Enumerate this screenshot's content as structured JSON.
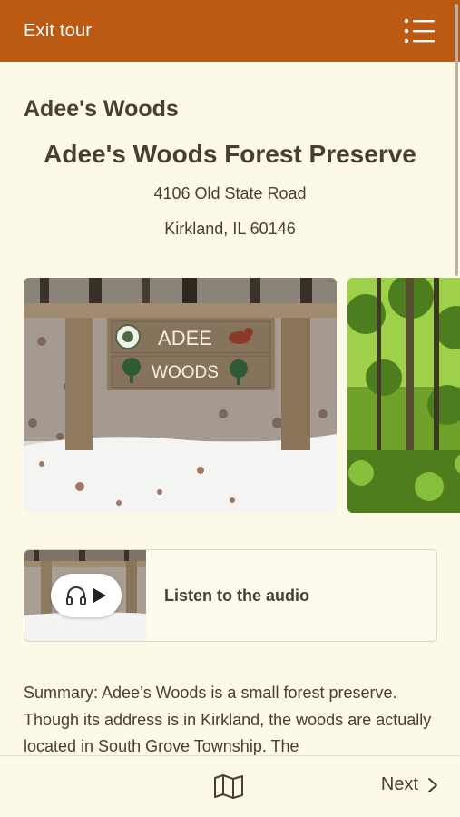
{
  "header": {
    "exit_label": "Exit tour",
    "menu_icon": "list-menu-icon",
    "background_color": "#bc5a14"
  },
  "site": {
    "name": "Adee's Woods",
    "title": "Adee's Woods Forest Preserve",
    "address_line1": "4106 Old State Road",
    "address_line2": "Kirkland, IL 60146"
  },
  "gallery": {
    "photos": [
      {
        "sign_line1": "ADEE",
        "sign_line2": "WOODS"
      },
      {
        "sign_line1": "",
        "sign_line2": ""
      }
    ]
  },
  "audio": {
    "label": "Listen to the audio",
    "icons": [
      "headphones-icon",
      "play-icon"
    ]
  },
  "summary": {
    "text": "Summary: Adee’s Woods is a small forest preserve. Though its address is in Kirkland, the woods are actually located in South Grove Township. The"
  },
  "footer": {
    "map_icon": "map-icon",
    "next_label": "Next",
    "next_icon": "chevron-right-icon"
  }
}
